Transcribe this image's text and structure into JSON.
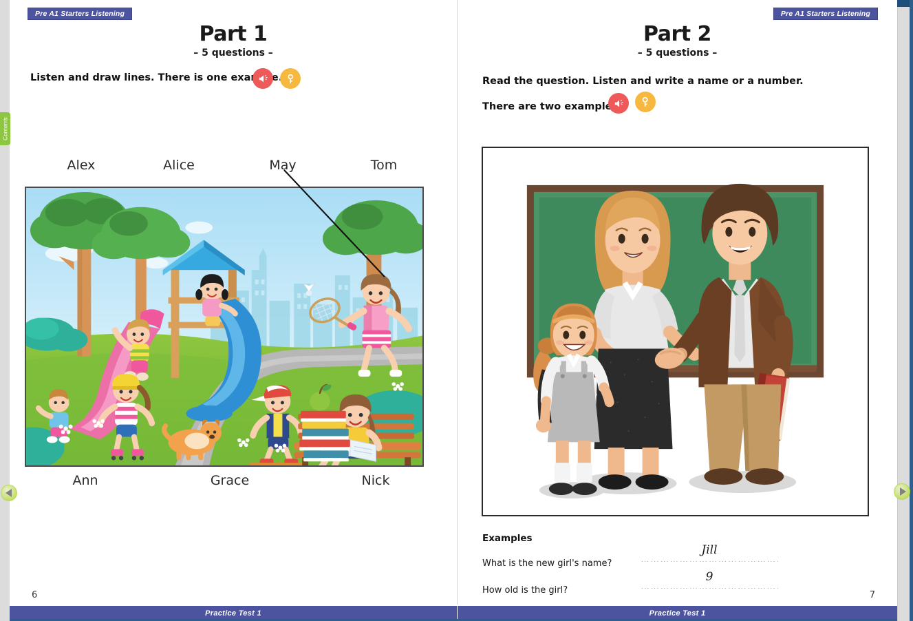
{
  "app": {
    "level_tag": "Pre A1 Starters Listening",
    "contents_tab_label": "Contents",
    "prev_label": "Previous page",
    "next_label": "Next page"
  },
  "left_page": {
    "number": "6",
    "footer": "Practice Test 1",
    "title": "Part 1",
    "subtitle": "– 5 questions –",
    "instruction": "Listen and draw lines. There is one example.",
    "icons": {
      "audio": "audio-speaker-icon",
      "key": "answer-key-icon"
    },
    "names_top": [
      "Alex",
      "Alice",
      "May",
      "Tom"
    ],
    "names_bottom": [
      "Ann",
      "Grace",
      "Nick"
    ],
    "picture_alt": "Children playing in a park playground with a slide, a dog, a skateboarder, a girl on roller skates, a girl reading on a bench and a girl playing badminton",
    "example_line": "Line drawn from the name May to the girl playing badminton"
  },
  "right_page": {
    "number": "7",
    "footer": "Practice Test 1",
    "title": "Part 2",
    "subtitle": "– 5 questions –",
    "instruction_line1": "Read the question. Listen and write a name or a number.",
    "instruction_line2": "There are two examples.",
    "icons": {
      "audio": "audio-speaker-icon",
      "key": "answer-key-icon"
    },
    "picture_alt": "A classroom with a green chalkboard, a woman and a man shaking hands, and a schoolgirl with a backpack holding the woman's hand",
    "examples_heading": "Examples",
    "examples": [
      {
        "question": "What is the new girl's name?",
        "answer": "Jill"
      },
      {
        "question": "How old is the girl?",
        "answer": "9"
      }
    ]
  },
  "colors": {
    "banner": "#4c54a0",
    "accent_green": "#8dc63f",
    "icon_audio": "#ee5a5a",
    "icon_key": "#f6b83f",
    "edge_blue": "#2d5f8a"
  }
}
